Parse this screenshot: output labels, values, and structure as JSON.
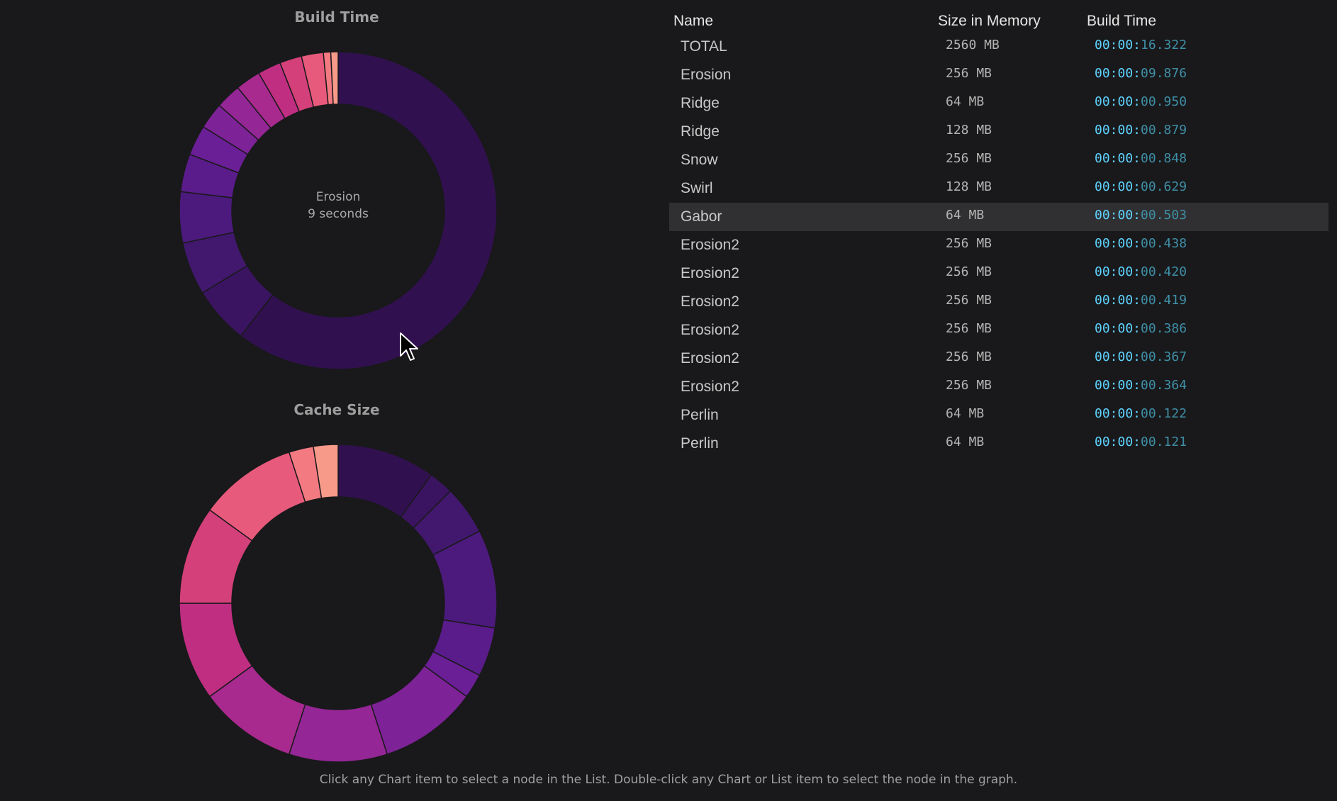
{
  "build_chart": {
    "title": "Build Time",
    "center_name": "Erosion",
    "center_value": "9 seconds"
  },
  "cache_chart": {
    "title": "Cache Size"
  },
  "list": {
    "columns": [
      "Name",
      "Size in Memory",
      "Build Time"
    ],
    "selected_index": 6,
    "rows": [
      {
        "name": "TOTAL",
        "size": "2560 MB",
        "time_lead": "00:00:",
        "time_tail": "16.322"
      },
      {
        "name": "Erosion",
        "size": "256 MB",
        "time_lead": "00:00:",
        "time_tail": "09.876"
      },
      {
        "name": "Ridge",
        "size": "64 MB",
        "time_lead": "00:00:",
        "time_tail": "00.950"
      },
      {
        "name": "Ridge",
        "size": "128 MB",
        "time_lead": "00:00:",
        "time_tail": "00.879"
      },
      {
        "name": "Snow",
        "size": "256 MB",
        "time_lead": "00:00:",
        "time_tail": "00.848"
      },
      {
        "name": "Swirl",
        "size": "128 MB",
        "time_lead": "00:00:",
        "time_tail": "00.629"
      },
      {
        "name": "Gabor",
        "size": "64 MB",
        "time_lead": "00:00:",
        "time_tail": "00.503"
      },
      {
        "name": "Erosion2",
        "size": "256 MB",
        "time_lead": "00:00:",
        "time_tail": "00.438"
      },
      {
        "name": "Erosion2",
        "size": "256 MB",
        "time_lead": "00:00:",
        "time_tail": "00.420"
      },
      {
        "name": "Erosion2",
        "size": "256 MB",
        "time_lead": "00:00:",
        "time_tail": "00.419"
      },
      {
        "name": "Erosion2",
        "size": "256 MB",
        "time_lead": "00:00:",
        "time_tail": "00.386"
      },
      {
        "name": "Erosion2",
        "size": "256 MB",
        "time_lead": "00:00:",
        "time_tail": "00.367"
      },
      {
        "name": "Erosion2",
        "size": "256 MB",
        "time_lead": "00:00:",
        "time_tail": "00.364"
      },
      {
        "name": "Perlin",
        "size": "64 MB",
        "time_lead": "00:00:",
        "time_tail": "00.122"
      },
      {
        "name": "Perlin",
        "size": "64 MB",
        "time_lead": "00:00:",
        "time_tail": "00.121"
      }
    ]
  },
  "footer": {
    "hint": "Click any Chart item to select a node in the List. Double-click any Chart or List item to select the node in the graph."
  },
  "chart_data": [
    {
      "type": "pie",
      "title": "Build Time",
      "categories": [
        "Erosion",
        "Ridge",
        "Ridge",
        "Snow",
        "Swirl",
        "Gabor",
        "Erosion2",
        "Erosion2",
        "Erosion2",
        "Erosion2",
        "Erosion2",
        "Erosion2",
        "Perlin",
        "Perlin"
      ],
      "values": [
        9.876,
        0.95,
        0.879,
        0.848,
        0.629,
        0.503,
        0.438,
        0.42,
        0.419,
        0.386,
        0.367,
        0.364,
        0.122,
        0.121
      ],
      "colors": [
        "#311050",
        "#3a1460",
        "#42186e",
        "#4c1a7c",
        "#5a1c8a",
        "#6a1f96",
        "#7e2298",
        "#942696",
        "#a82a8e",
        "#c02e82",
        "#d4407a",
        "#e85a7c",
        "#f47a82",
        "#f89a8a",
        "#fcb896",
        "#fdd2a8",
        "#fde8b4"
      ]
    },
    {
      "type": "pie",
      "title": "Cache Size",
      "categories": [
        "Erosion",
        "Ridge",
        "Ridge",
        "Snow",
        "Swirl",
        "Gabor",
        "Erosion2",
        "Erosion2",
        "Erosion2",
        "Erosion2",
        "Erosion2",
        "Erosion2",
        "Perlin",
        "Perlin"
      ],
      "values": [
        256,
        64,
        128,
        256,
        128,
        64,
        256,
        256,
        256,
        256,
        256,
        256,
        64,
        64
      ],
      "colors": [
        "#311050",
        "#3a1460",
        "#42186e",
        "#4c1a7c",
        "#5a1c8a",
        "#6a1f96",
        "#7e2298",
        "#942696",
        "#a82a8e",
        "#c02e82",
        "#d4407a",
        "#e85a7c",
        "#f47a82",
        "#f89a8a",
        "#fcb896",
        "#fdd2a8",
        "#fde8b4"
      ]
    }
  ]
}
